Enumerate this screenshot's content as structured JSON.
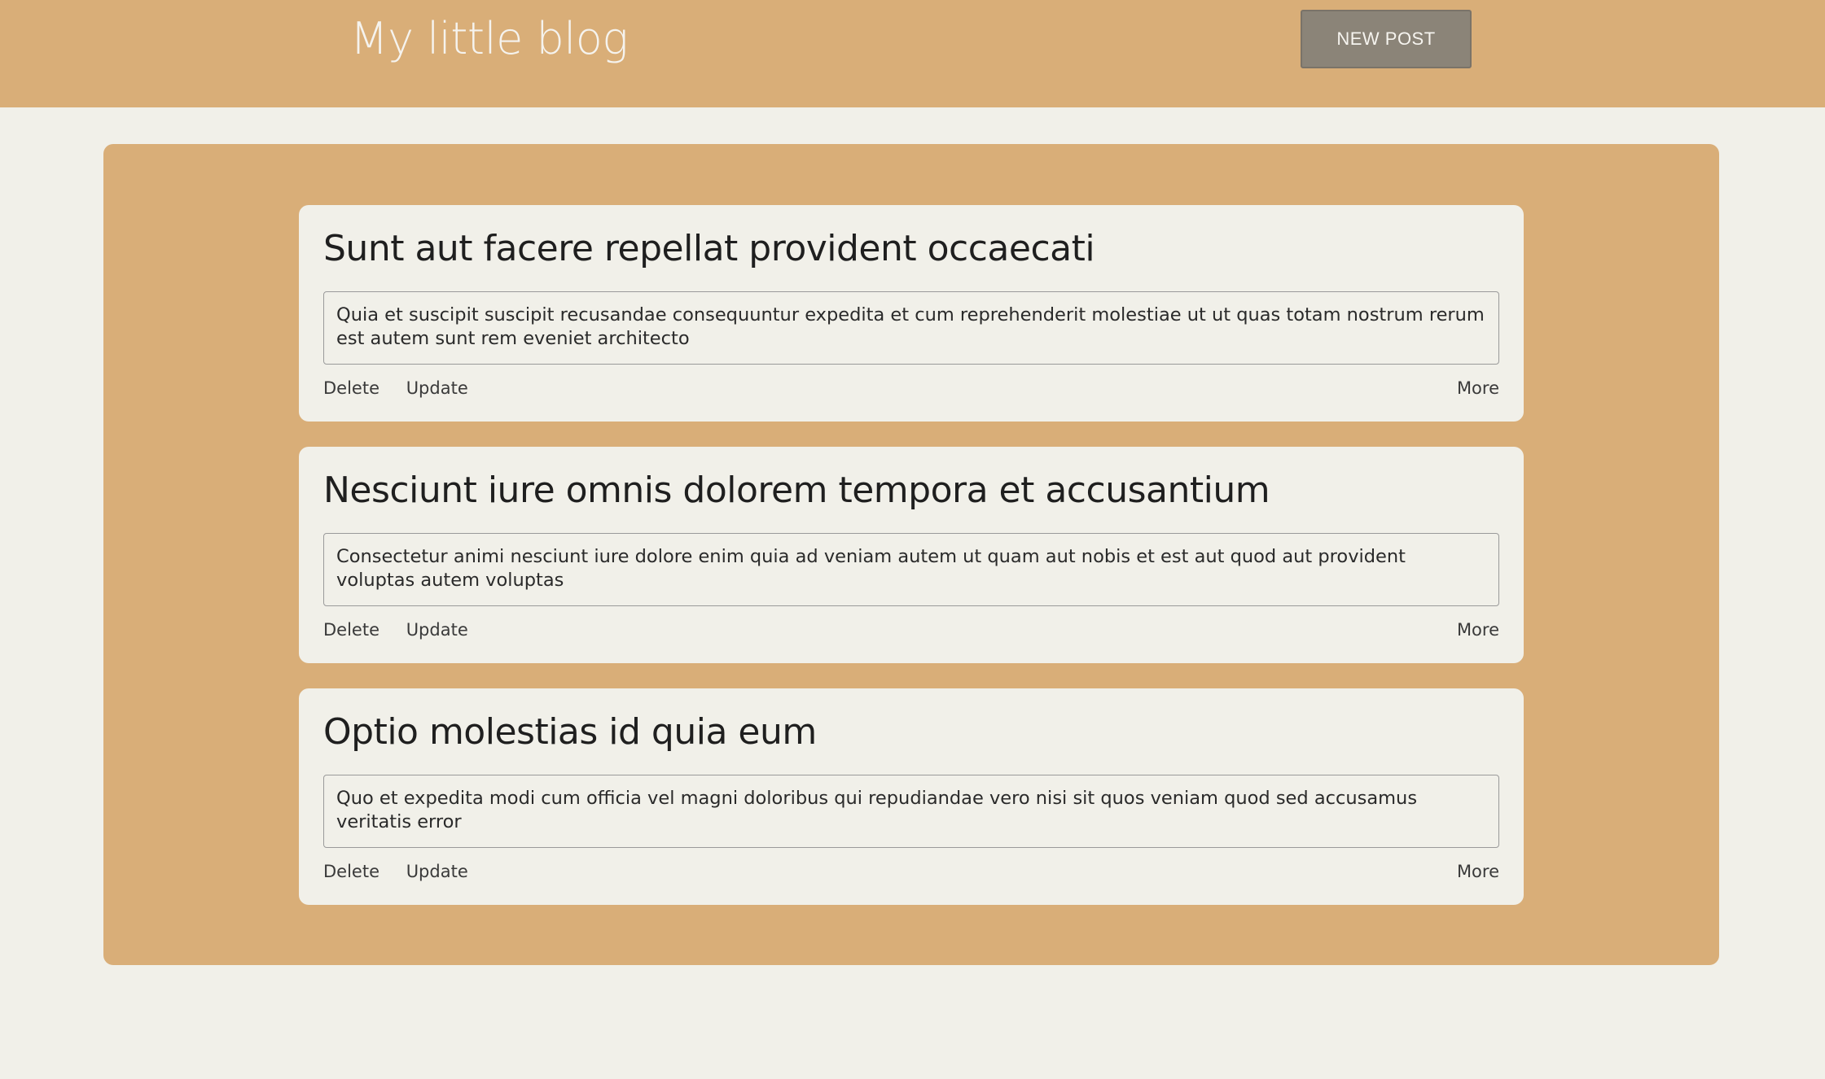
{
  "header": {
    "title": "My little blog",
    "new_post_label": "NEW POST"
  },
  "posts": [
    {
      "title": "Sunt aut facere repellat provident occaecati",
      "body": "Quia et suscipit suscipit recusandae consequuntur expedita et cum reprehenderit molestiae ut ut quas totam nostrum rerum est autem sunt rem eveniet architecto",
      "delete_label": "Delete",
      "update_label": "Update",
      "more_label": "More"
    },
    {
      "title": "Nesciunt iure omnis dolorem tempora et accusantium",
      "body": "Consectetur animi nesciunt iure dolore enim quia ad veniam autem ut quam aut nobis et est aut quod aut provident voluptas autem voluptas",
      "delete_label": "Delete",
      "update_label": "Update",
      "more_label": "More"
    },
    {
      "title": "Optio molestias id quia eum",
      "body": "Quo et expedita modi cum officia vel magni doloribus qui repudiandae vero nisi sit quos veniam quod sed accusamus veritatis error",
      "delete_label": "Delete",
      "update_label": "Update",
      "more_label": "More"
    }
  ],
  "colors": {
    "header_bg": "#d9ae78",
    "page_bg": "#f1f0e9",
    "button_bg": "#8b8478"
  }
}
